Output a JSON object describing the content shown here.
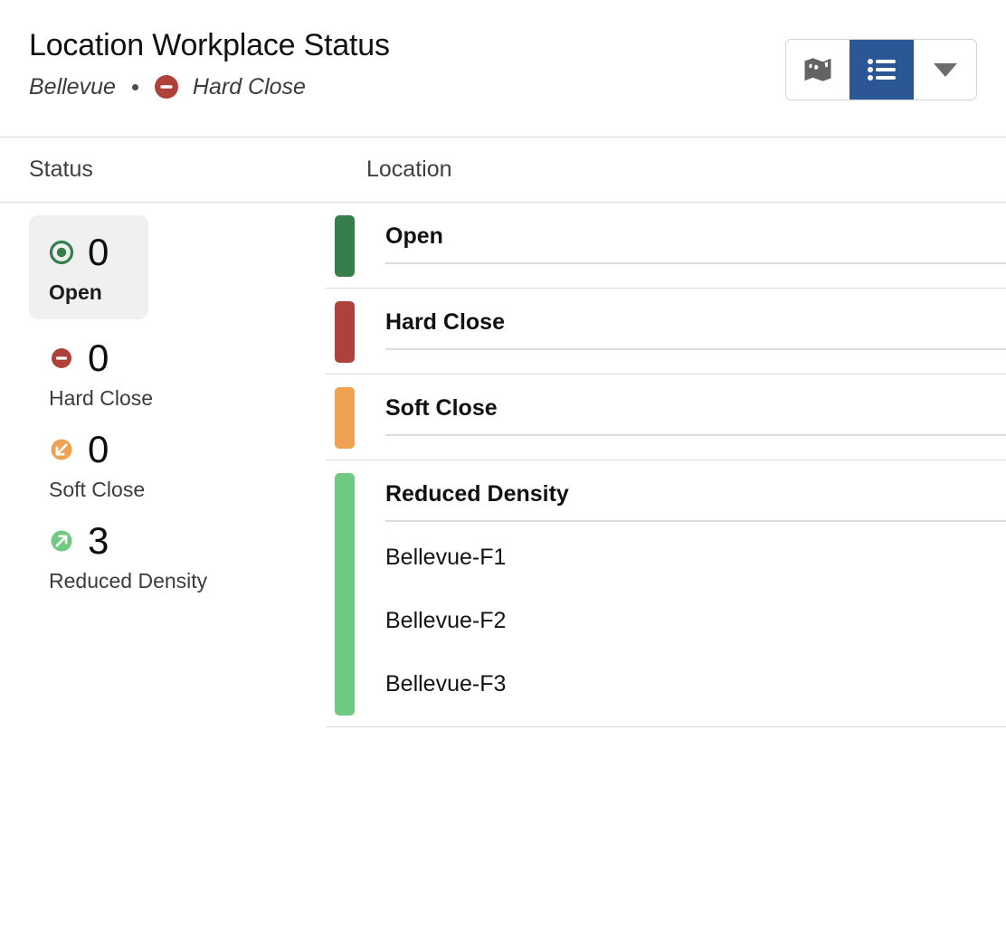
{
  "header": {
    "title": "Location Workplace Status",
    "subtitle_location": "Bellevue",
    "subtitle_separator": "•",
    "subtitle_status": "Hard Close",
    "subtitle_status_icon": "hard-close-icon"
  },
  "toolbar": {
    "map_view_label": "Map view",
    "map_view_icon": "map-icon",
    "list_view_label": "List view",
    "list_view_icon": "list-icon",
    "list_view_active": true,
    "dropdown_label": "More options",
    "dropdown_icon": "chevron-down-icon",
    "active_color": "#2b5797"
  },
  "columns": {
    "status_header": "Status",
    "location_header": "Location"
  },
  "status_summary": [
    {
      "count": "0",
      "label": "Open",
      "icon": "open-icon",
      "color": "#367f4d",
      "selected": true
    },
    {
      "count": "0",
      "label": "Hard Close",
      "icon": "hard-close-icon",
      "color": "#b0413a",
      "selected": false
    },
    {
      "count": "0",
      "label": "Soft Close",
      "icon": "soft-close-icon",
      "color": "#efa252",
      "selected": false
    },
    {
      "count": "3",
      "label": "Reduced Density",
      "icon": "reduced-density-icon",
      "color": "#6fc980",
      "selected": false
    }
  ],
  "location_groups": [
    {
      "title": "Open",
      "color": "#367f4d",
      "items": []
    },
    {
      "title": "Hard Close",
      "color": "#b0413a",
      "items": []
    },
    {
      "title": "Soft Close",
      "color": "#efa252",
      "items": []
    },
    {
      "title": "Reduced Density",
      "color": "#6fc980",
      "items": [
        {
          "name": "Bellevue-F1"
        },
        {
          "name": "Bellevue-F2"
        },
        {
          "name": "Bellevue-F3"
        }
      ]
    }
  ]
}
